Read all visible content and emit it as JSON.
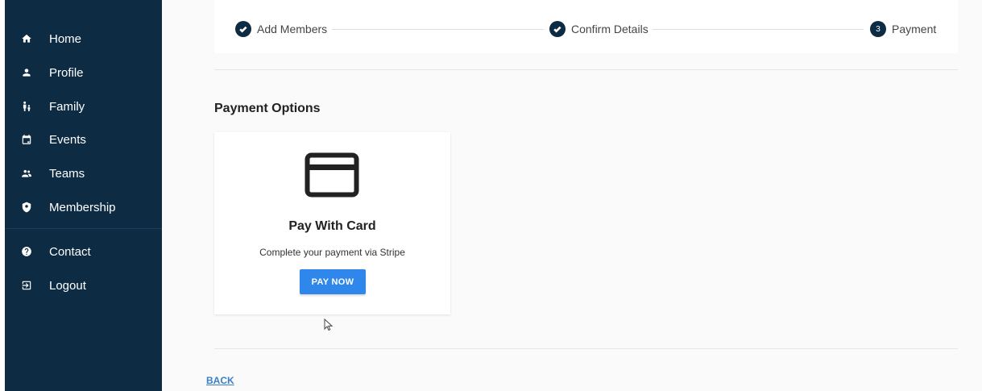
{
  "sidebar": {
    "items": [
      {
        "label": "Home",
        "icon": "home-icon"
      },
      {
        "label": "Profile",
        "icon": "person-icon"
      },
      {
        "label": "Family",
        "icon": "family-icon"
      },
      {
        "label": "Events",
        "icon": "calendar-icon"
      },
      {
        "label": "Teams",
        "icon": "group-icon"
      },
      {
        "label": "Membership",
        "icon": "shield-icon"
      },
      {
        "label": "Contact",
        "icon": "help-icon"
      },
      {
        "label": "Logout",
        "icon": "logout-icon"
      }
    ]
  },
  "stepper": {
    "steps": [
      {
        "label": "Add Members",
        "state": "completed"
      },
      {
        "label": "Confirm Details",
        "state": "completed"
      },
      {
        "label": "Payment",
        "state": "active",
        "number": "3"
      }
    ]
  },
  "main": {
    "section_title": "Payment Options",
    "card": {
      "icon": "credit-card-icon",
      "title": "Pay With Card",
      "subtitle": "Complete your payment via Stripe",
      "button_label": "PAY NOW"
    },
    "back_label": "BACK"
  },
  "colors": {
    "sidebar_bg": "#0d2b43",
    "accent_button": "#2f86eb",
    "link": "#3b7fc4"
  }
}
